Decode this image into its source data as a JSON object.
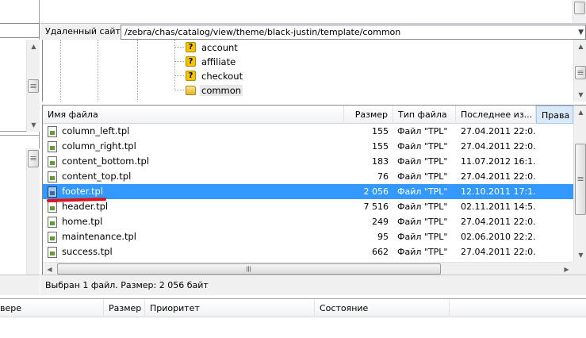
{
  "remote_site": {
    "label": "Удаленный сайт:",
    "path": "/zebra/chas/catalog/view/theme/black-justin/template/common"
  },
  "tree": {
    "items": [
      {
        "label": "account",
        "icon": "question-folder-icon"
      },
      {
        "label": "affiliate",
        "icon": "question-folder-icon"
      },
      {
        "label": "checkout",
        "icon": "question-folder-icon"
      },
      {
        "label": "common",
        "icon": "folder-icon",
        "current": true
      }
    ]
  },
  "file_list": {
    "columns": {
      "name": "Имя файла",
      "size": "Размер",
      "type": "Тип файла",
      "modified": "Последнее из...",
      "perms": "Права"
    },
    "rows": [
      {
        "name": "column_left.tpl",
        "size": "155",
        "type": "Файл \"TPL\"",
        "modified": "27.04.2011 22:0..."
      },
      {
        "name": "column_right.tpl",
        "size": "155",
        "type": "Файл \"TPL\"",
        "modified": "27.04.2011 22:0..."
      },
      {
        "name": "content_bottom.tpl",
        "size": "183",
        "type": "Файл \"TPL\"",
        "modified": "11.07.2012 16:1..."
      },
      {
        "name": "content_top.tpl",
        "size": "76",
        "type": "Файл \"TPL\"",
        "modified": "27.04.2011 22:0..."
      },
      {
        "name": "footer.tpl",
        "size": "2 056",
        "type": "Файл \"TPL\"",
        "modified": "12.10.2011 17:1...",
        "selected": true
      },
      {
        "name": "header.tpl",
        "size": "7 516",
        "type": "Файл \"TPL\"",
        "modified": "02.11.2011 14:5..."
      },
      {
        "name": "home.tpl",
        "size": "249",
        "type": "Файл \"TPL\"",
        "modified": "27.04.2011 22:0..."
      },
      {
        "name": "maintenance.tpl",
        "size": "95",
        "type": "Файл \"TPL\"",
        "modified": "02.06.2010 22:2..."
      },
      {
        "name": "success.tpl",
        "size": "662",
        "type": "Файл \"TPL\"",
        "modified": "27.04.2011 22:0..."
      }
    ]
  },
  "status": {
    "text": "Выбран 1 файл. Размер: 2 056 байт"
  },
  "queue": {
    "columns": {
      "server": "вере",
      "size": "Размер",
      "priority": "Приоритет",
      "state": "Состояние"
    }
  },
  "colors": {
    "selection": "#3399ff",
    "annotation": "#e0161c"
  }
}
